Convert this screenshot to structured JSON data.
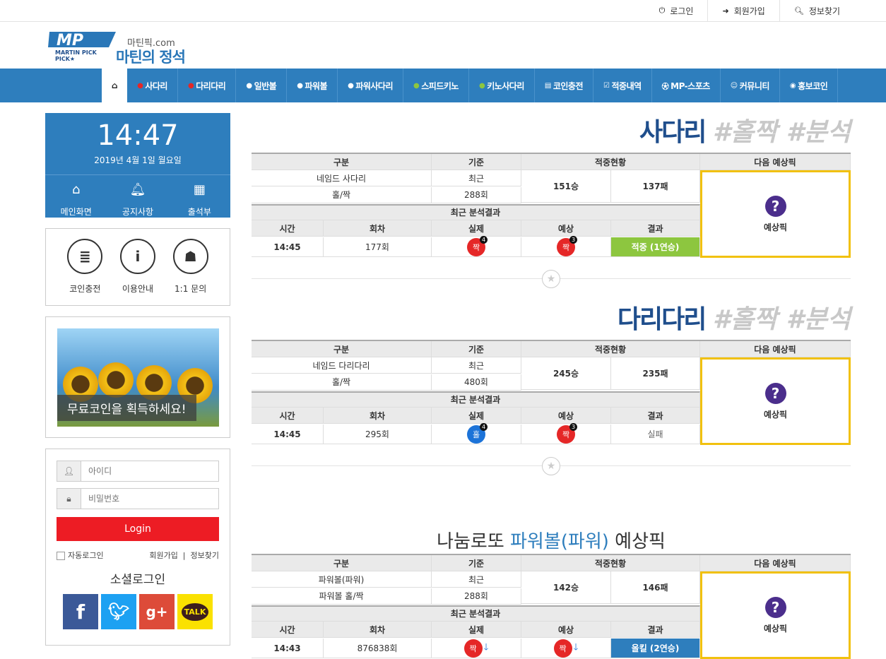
{
  "top_links": [
    {
      "icon": "power-icon",
      "label": "로그인"
    },
    {
      "icon": "signin-icon",
      "label": "회원가입"
    },
    {
      "icon": "search-icon",
      "label": "정보찾기"
    }
  ],
  "logo": {
    "mark": "MP",
    "sub": "MARTIN PICK",
    "domain": "마틴픽.com",
    "tagline": "마틴의 정석"
  },
  "nav": [
    "사다리",
    "다리다리",
    "일반볼",
    "파워볼",
    "파워사다리",
    "스피드키노",
    "키노사다리",
    "코인충전",
    "적중내역",
    "MP-스포츠",
    "커뮤니티",
    "홍보코인"
  ],
  "clock": {
    "time": "14:47",
    "date": "2019년 4월 1일 월요일",
    "links": [
      "메인화면",
      "공지사항",
      "출석부"
    ]
  },
  "quick_links": [
    "코인충전",
    "이용안내",
    "1:1 문의"
  ],
  "banner_text": "무료코인을 획득하세요!",
  "login": {
    "id_placeholder": "아이디",
    "pw_placeholder": "비밀번호",
    "button": "Login",
    "auto": "자동로그인",
    "join": "회원가입",
    "find": "정보찾기",
    "social_title": "소셜로그인",
    "talk": "TALK"
  },
  "headers": {
    "gubun": "구분",
    "gijun": "기준",
    "status": "적중현황",
    "next": "다음 예상픽",
    "recent": "최근 분석결과",
    "time": "시간",
    "round": "회차",
    "actual": "실제",
    "predict": "예상",
    "result": "결과",
    "pick": "예상픽"
  },
  "sections": [
    {
      "title_a": "사다리",
      "title_b": "#홀짝 #분석",
      "row1": "네임드 사다리",
      "row2": "홀/짝",
      "recent": "최근",
      "rounds": "288회",
      "win": "151승",
      "lose": "137패",
      "time": "14:45",
      "round": "177회",
      "actual": "짝",
      "actual_n": "4",
      "pred": "짝",
      "pred_n": "3",
      "result": "적중 (1연승)"
    },
    {
      "title_a": "다리다리",
      "title_b": "#홀짝 #분석",
      "row1": "네임드 다리다리",
      "row2": "홀/짝",
      "recent": "최근",
      "rounds": "480회",
      "win": "245승",
      "lose": "235패",
      "time": "14:45",
      "round": "295회",
      "actual": "홀",
      "actual_n": "4",
      "pred": "짝",
      "pred_n": "3",
      "result": "실패"
    },
    {
      "row1": "파워볼(파워)",
      "row2": "파워볼 홀/짝",
      "recent": "최근",
      "rounds": "288회",
      "win": "142승",
      "lose": "146패",
      "time": "14:43",
      "round": "876838회",
      "actual": "짝",
      "pred": "짝",
      "result": "올킬 (2연승)"
    }
  ],
  "lotto": {
    "a": "나눔로또 ",
    "b": "파워볼(파워)",
    "c": " 예상픽"
  },
  "colors": {
    "nav": "#2e7ebd",
    "hit": "#8dc63f",
    "allkill": "#2e7ebd",
    "pick_border": "#f1c10e",
    "login": "#ed1c24"
  }
}
